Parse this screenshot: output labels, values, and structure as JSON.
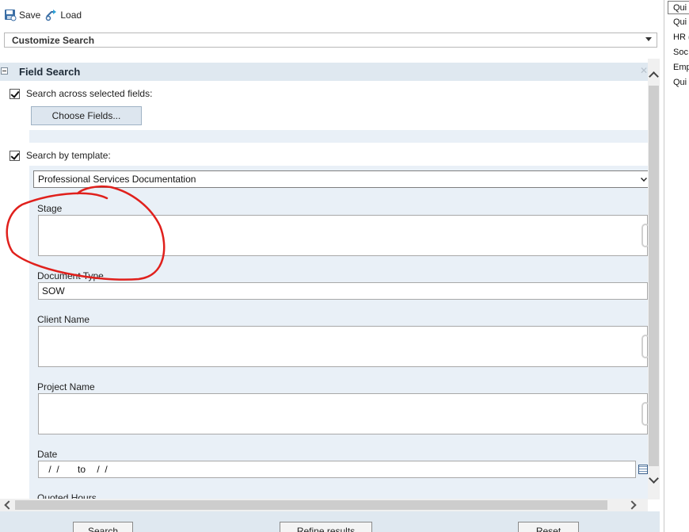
{
  "toolbar": {
    "save_label": "Save",
    "load_label": "Load"
  },
  "customize": {
    "value": "Customize Search"
  },
  "field_search": {
    "title": "Field Search",
    "across_label": "Search across selected fields:",
    "across_checked": true,
    "choose_fields_label": "Choose Fields...",
    "template_label": "Search by template:",
    "template_checked": true,
    "template_value": "Professional Services Documentation"
  },
  "fields": {
    "stage": {
      "label": "Stage",
      "value": ""
    },
    "document_type": {
      "label": "Document Type",
      "value": "SOW"
    },
    "client_name": {
      "label": "Client Name",
      "value": ""
    },
    "project_name": {
      "label": "Project Name",
      "value": ""
    },
    "date": {
      "label": "Date",
      "from": " /  /",
      "to_label": "to",
      "to": " /  /"
    },
    "quoted_hours": {
      "label": "Quoted Hours"
    }
  },
  "footer": {
    "search_label": "Search",
    "refine_label": "Refine results",
    "reset_label": "Reset"
  },
  "right_list": [
    "Qui",
    "Qui",
    "HR (",
    "Soc",
    "Emp",
    "Qui"
  ],
  "colors": {
    "annotation": "#e0201c",
    "header_bg": "#dfe8f0",
    "panel_bg": "#e9f0f7"
  }
}
